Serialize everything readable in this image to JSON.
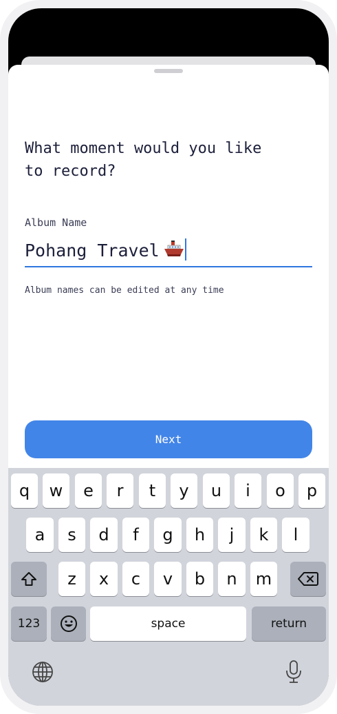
{
  "form": {
    "question_line1": "What moment would you like",
    "question_line2": "to record?",
    "album_label": "Album Name",
    "album_value": "Pohang Travel",
    "helper_text": "Album names can be edited at any time",
    "next_label": "Next"
  },
  "keyboard": {
    "row1": [
      "q",
      "w",
      "e",
      "r",
      "t",
      "y",
      "u",
      "i",
      "o",
      "p"
    ],
    "row2": [
      "a",
      "s",
      "d",
      "f",
      "g",
      "h",
      "j",
      "k",
      "l"
    ],
    "row3": [
      "z",
      "x",
      "c",
      "v",
      "b",
      "n",
      "m"
    ],
    "numbers_label": "123",
    "space_label": "space",
    "return_label": "return"
  },
  "colors": {
    "accent": "#4285e8",
    "text": "#1c1f3a",
    "keyboard_bg": "#d1d4db"
  },
  "icons": [
    "ship-emoji",
    "shift-icon",
    "delete-icon",
    "emoji-icon",
    "globe-icon",
    "microphone-icon"
  ]
}
